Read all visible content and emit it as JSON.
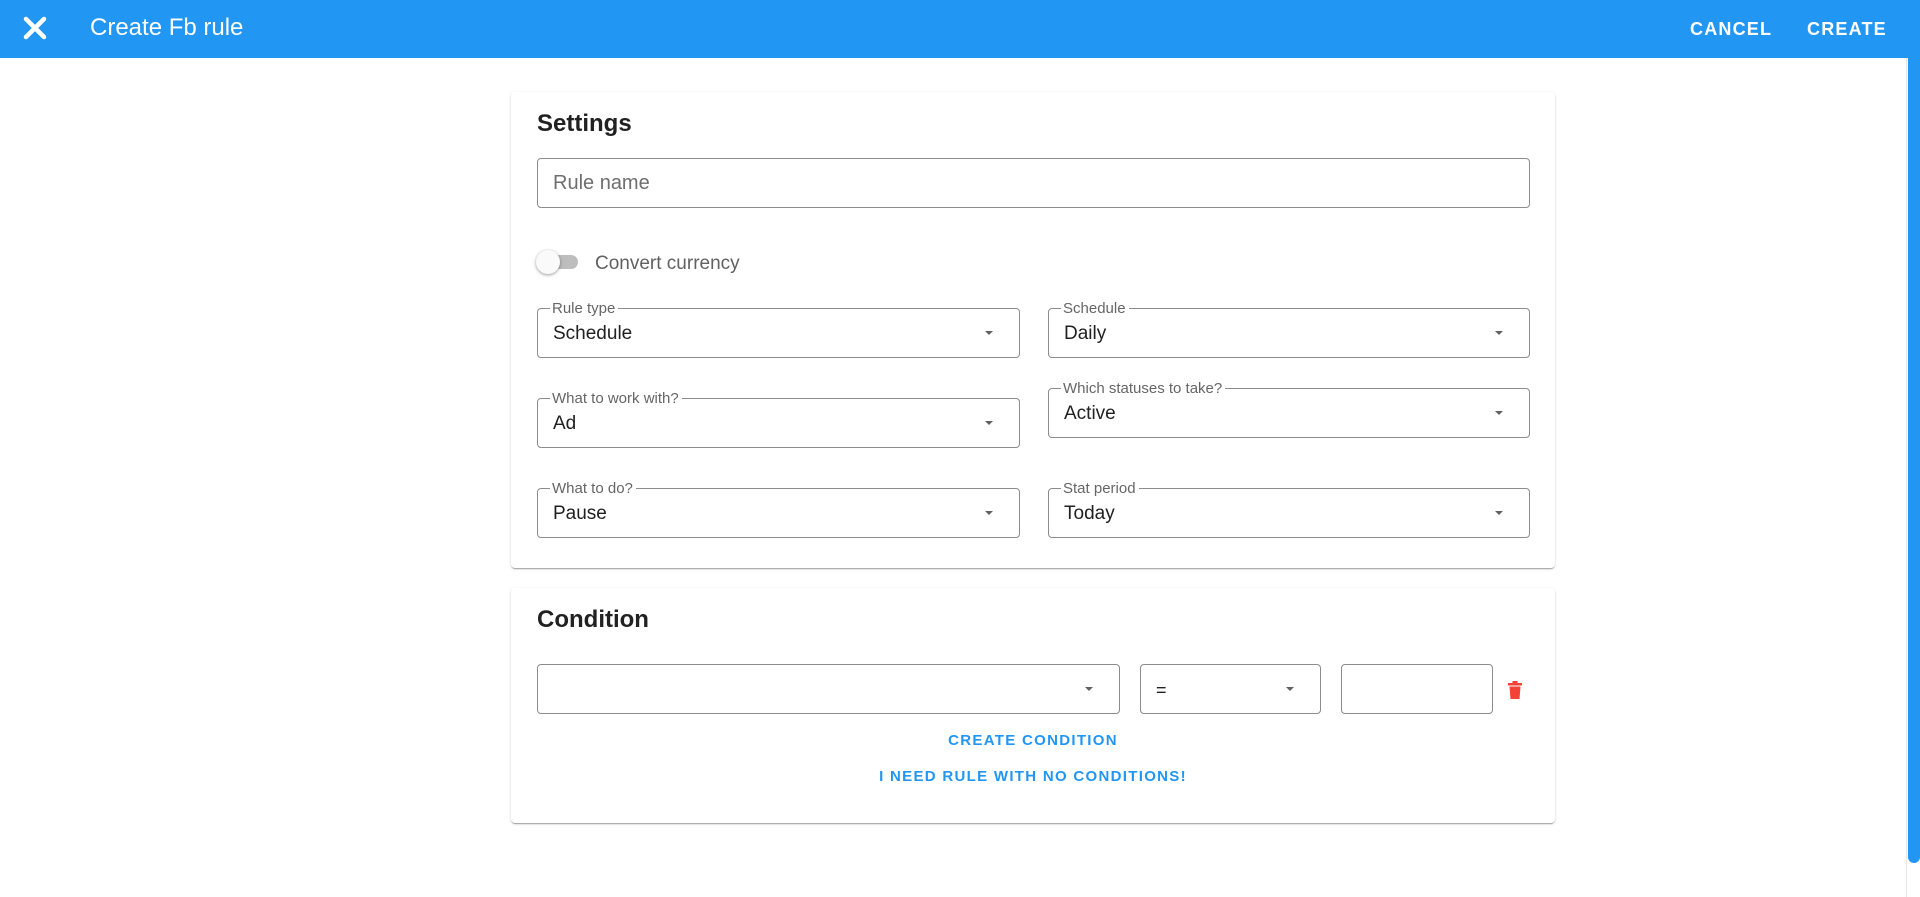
{
  "appbar": {
    "title": "Create Fb rule",
    "close_icon": "close-icon",
    "cancel_label": "CANCEL",
    "create_label": "CREATE",
    "color": "#2196f3"
  },
  "settings": {
    "title": "Settings",
    "rule_name_placeholder": "Rule name",
    "rule_name_value": "",
    "convert_currency_label": "Convert currency",
    "convert_currency_on": false,
    "rule_type": {
      "label": "Rule type",
      "value": "Schedule"
    },
    "schedule": {
      "label": "Schedule",
      "value": "Daily"
    },
    "work_with": {
      "label": "What to work with?",
      "value": "Ad"
    },
    "statuses": {
      "label": "Which statuses to take?",
      "value": "Active"
    },
    "what_to_do": {
      "label": "What to do?",
      "value": "Pause"
    },
    "stat_period": {
      "label": "Stat period",
      "value": "Today"
    }
  },
  "condition": {
    "title": "Condition",
    "field_value": "",
    "operator_value": "=",
    "amount_value": "",
    "delete_icon": "trash-icon",
    "delete_color": "#f44336",
    "create_condition_label": "CREATE CONDITION",
    "no_conditions_label": "I NEED RULE WITH NO CONDITIONS!",
    "accent": "#2196f3"
  }
}
